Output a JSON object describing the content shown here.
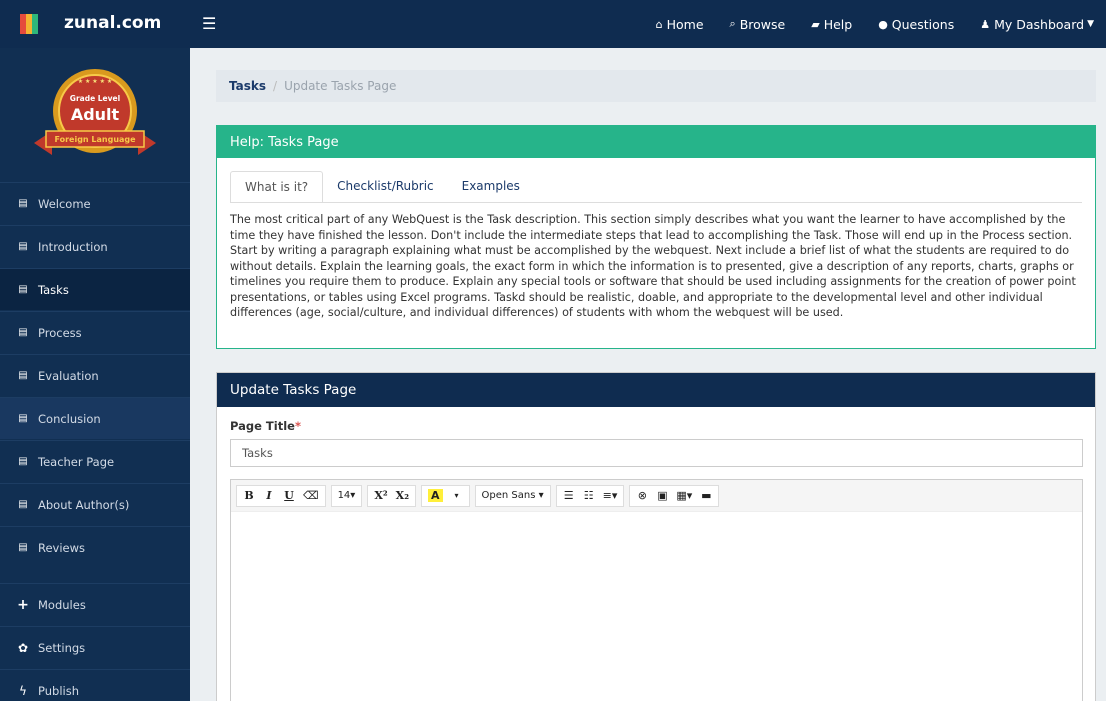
{
  "navbar": {
    "brand": "zunal.com",
    "links": [
      {
        "icon": "home-icon",
        "label": "Home"
      },
      {
        "icon": "search-icon",
        "label": "Browse"
      },
      {
        "icon": "book-icon",
        "label": "Help"
      },
      {
        "icon": "comments-icon",
        "label": "Questions"
      },
      {
        "icon": "user-icon",
        "label": "My Dashboard"
      }
    ]
  },
  "badge": {
    "line1": "Grade Level",
    "line2": "Adult",
    "line3": "Foreign Language"
  },
  "sidebar": {
    "items": [
      {
        "label": "Welcome",
        "icon": "page-icon"
      },
      {
        "label": "Introduction",
        "icon": "page-icon"
      },
      {
        "label": "Tasks",
        "icon": "page-icon"
      },
      {
        "label": "Process",
        "icon": "page-icon"
      },
      {
        "label": "Evaluation",
        "icon": "page-icon"
      },
      {
        "label": "Conclusion",
        "icon": "page-icon"
      },
      {
        "label": "Teacher Page",
        "icon": "page-icon"
      },
      {
        "label": "About Author(s)",
        "icon": "page-icon"
      },
      {
        "label": "Reviews",
        "icon": "page-icon"
      }
    ],
    "tools": [
      {
        "label": "Modules",
        "icon": "plus-icon"
      },
      {
        "label": "Settings",
        "icon": "gear-icon"
      },
      {
        "label": "Publish",
        "icon": "bolt-icon"
      }
    ]
  },
  "breadcrumb": {
    "link": "Tasks",
    "separator": "/",
    "current": "Update Tasks Page"
  },
  "help": {
    "title": "Help: Tasks Page",
    "tabs": [
      "What is it?",
      "Checklist/Rubric",
      "Examples"
    ],
    "text": "The most critical part of any WebQuest is the Task description. This section simply describes what you want the learner to have accomplished by the time they have finished the lesson. Don't include the intermediate steps that lead to accomplishing the Task. Those will end up in the Process section. Start by writing a paragraph explaining what must be accomplished by the webquest. Next include a brief list of what the students are required to do without details. Explain the learning goals, the exact form in which the information is to presented, give a description of any reports, charts, graphs or timelines you require them to produce. Explain any special tools or software that should be used including assignments for the creation of power point presentations, or tables using Excel programs. Taskd should be realistic, doable, and appropriate to the developmental level and other individual differences (age, social/culture, and individual differences) of students with whom the webquest will be used."
  },
  "update": {
    "title": "Update Tasks Page",
    "field_label": "Page Title",
    "required_mark": "*",
    "field_value": "Tasks",
    "toolbar": {
      "bold": "B",
      "italic": "I",
      "underline": "U",
      "eraser": "⌫",
      "font_size": "14▾",
      "superscript": "X²",
      "subscript": "X₂",
      "color": "A",
      "color_caret": "▾",
      "font_name": "Open Sans ▾",
      "ul": "☰",
      "ol": "☷",
      "align": "≡▾",
      "link": "⊗",
      "image": "▣",
      "table": "▦▾",
      "video": "▬"
    }
  },
  "colors": {
    "navbar": "#0f2c50",
    "sidebar": "#112f52",
    "help_accent": "#26b48a",
    "highlight": "#ffef3a",
    "required": "#d9534f"
  }
}
